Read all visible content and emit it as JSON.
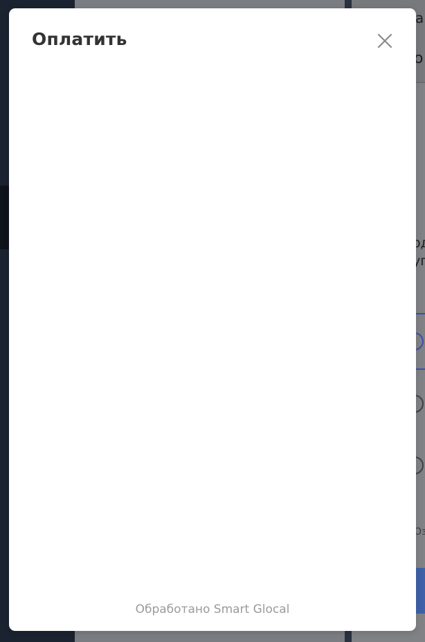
{
  "background": {
    "fragments": [
      "а",
      "о",
      "од",
      "уп",
      "Оз"
    ]
  },
  "modal": {
    "title": "Оплатить",
    "close_icon": "close-icon",
    "footer": "Обработано Smart Glocal"
  },
  "colors": {
    "modal_bg": "#ffffff",
    "title": "#333333",
    "footer_text": "#9a9a9a",
    "accent": "#3e61a8"
  }
}
